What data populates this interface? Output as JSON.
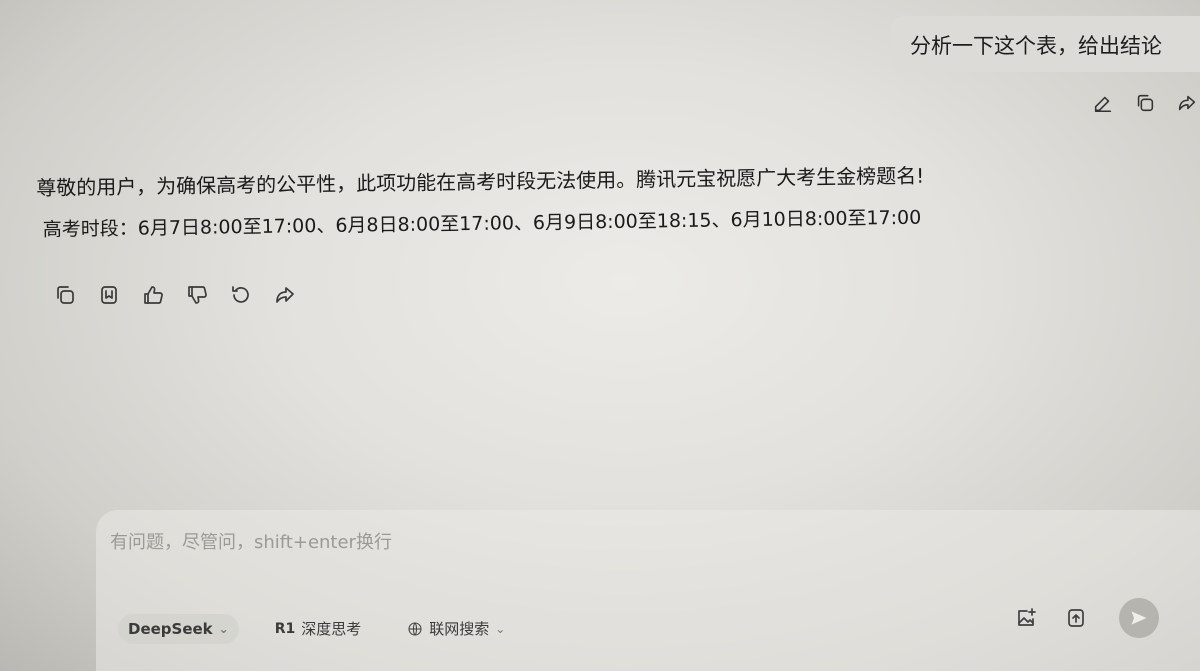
{
  "user_message": {
    "text": "分析一下这个表，给出结论",
    "actions": [
      "edit-icon",
      "copy-icon",
      "share-icon"
    ]
  },
  "answer": {
    "line1": "尊敬的用户，为确保高考的公平性，此项功能在高考时段无法使用。腾讯元宝祝愿广大考生金榜题名!",
    "line2": "高考时段：6月7日8:00至17:00、6月8日8:00至17:00、6月9日8:00至18:15、6月10日8:00至17:00",
    "actions": [
      "copy-icon",
      "bookmark-icon",
      "thumbs-up-icon",
      "thumbs-down-icon",
      "regenerate-icon",
      "share-icon"
    ]
  },
  "composer": {
    "placeholder": "有问题，尽管问，shift+enter换行",
    "model_label": "DeepSeek",
    "deep_think_badge": "R1",
    "deep_think_label": "深度思考",
    "web_search_label": "联网搜索"
  }
}
